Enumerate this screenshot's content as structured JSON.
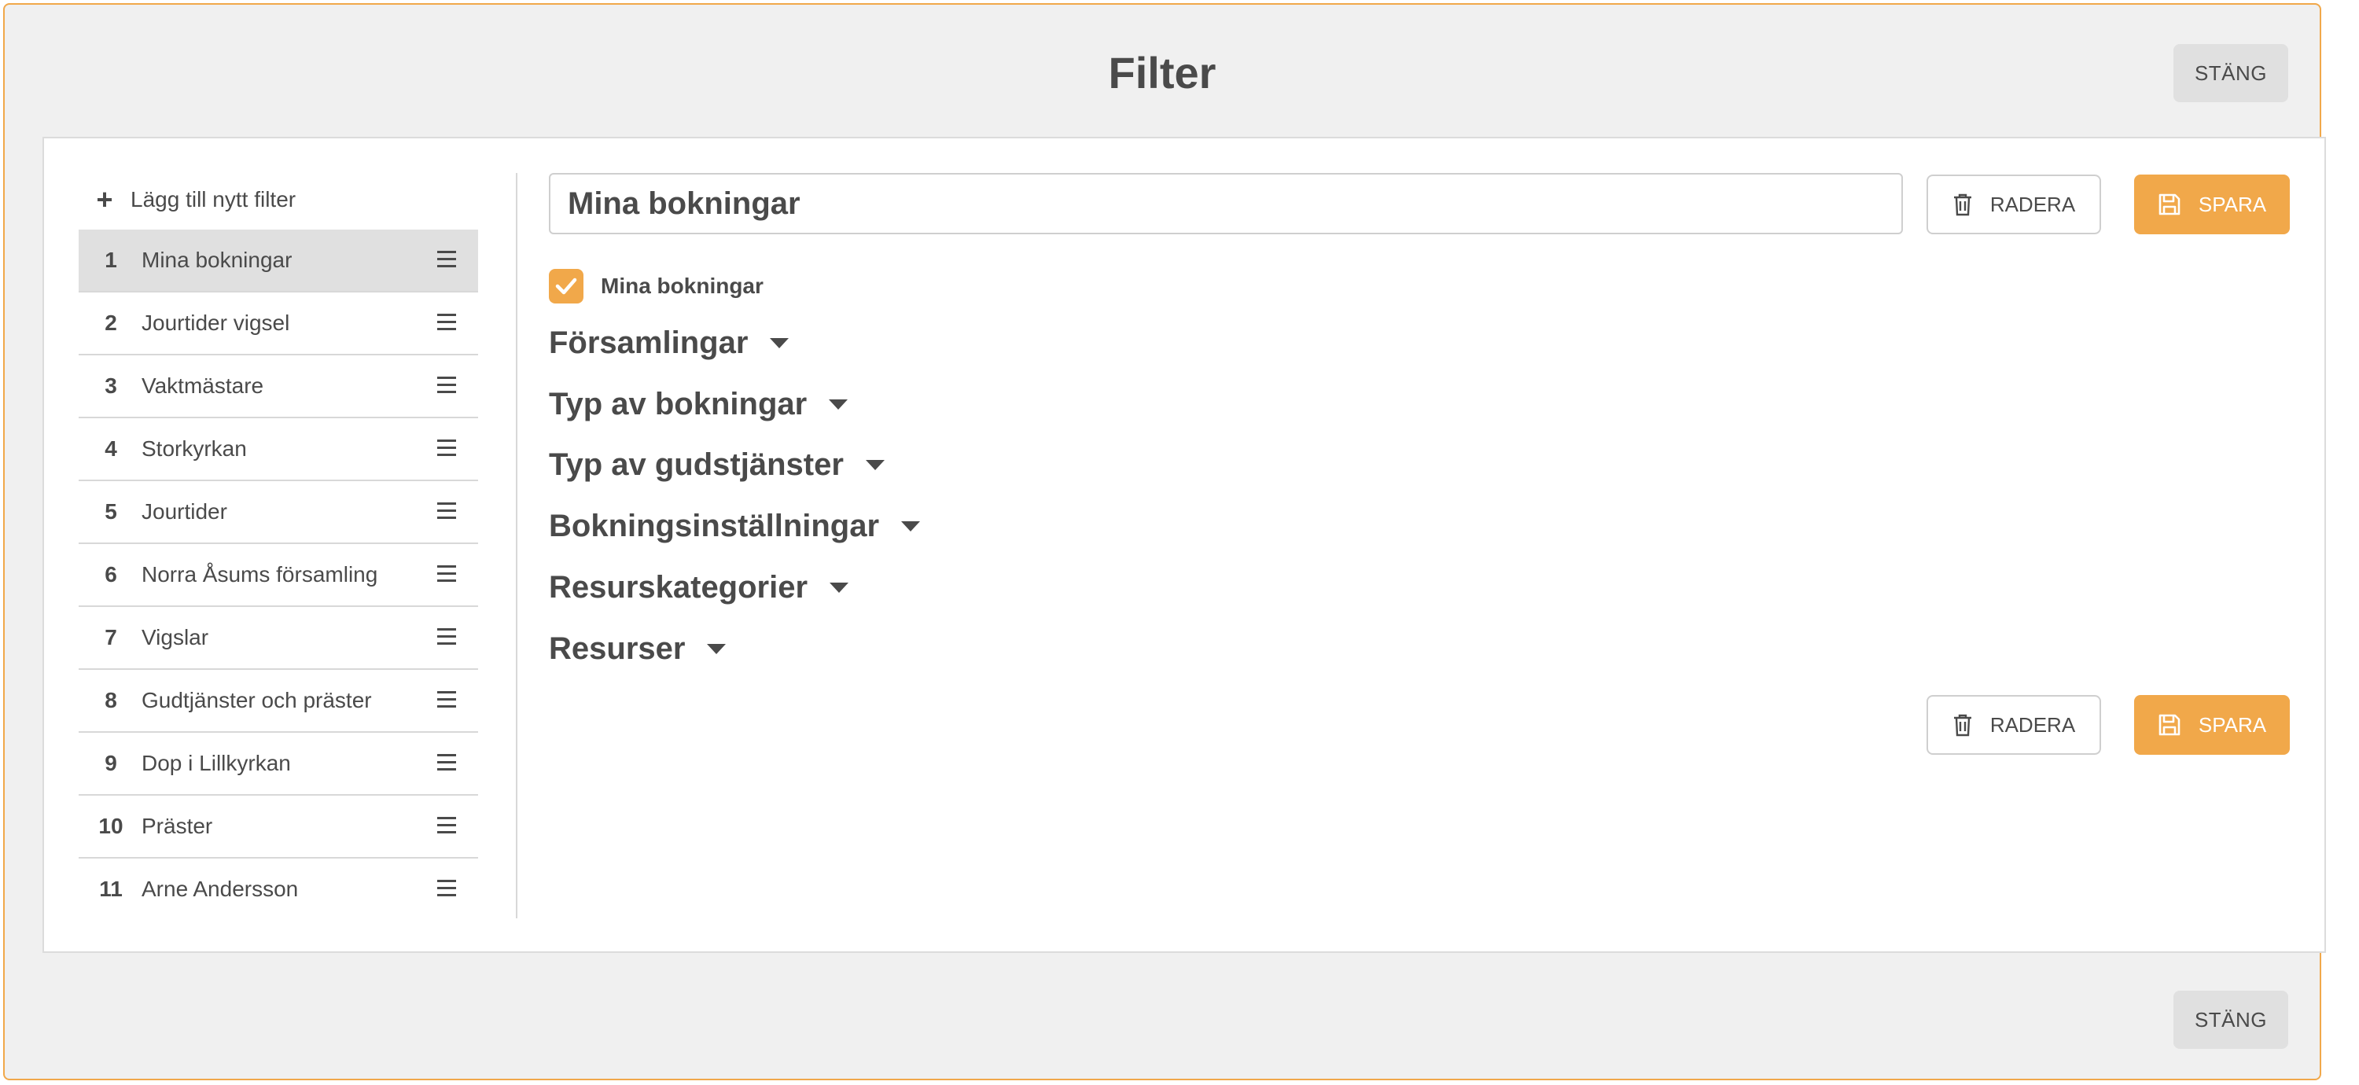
{
  "modal": {
    "title": "Filter",
    "close_label": "STÄNG",
    "accent_color": "#f1a84a"
  },
  "sidebar": {
    "add_label": "Lägg till nytt filter",
    "items": [
      {
        "num": "1",
        "label": "Mina bokningar",
        "active": true
      },
      {
        "num": "2",
        "label": "Jourtider vigsel"
      },
      {
        "num": "3",
        "label": "Vaktmästare"
      },
      {
        "num": "4",
        "label": "Storkyrkan"
      },
      {
        "num": "5",
        "label": "Jourtider"
      },
      {
        "num": "6",
        "label": "Norra Åsums församling"
      },
      {
        "num": "7",
        "label": "Vigslar"
      },
      {
        "num": "8",
        "label": "Gudtjänster och präster"
      },
      {
        "num": "9",
        "label": "Dop i Lillkyrkan"
      },
      {
        "num": "10",
        "label": "Präster"
      },
      {
        "num": "11",
        "label": "Arne Andersson"
      }
    ]
  },
  "editor": {
    "name_value": "Mina bokningar",
    "delete_label": "RADERA",
    "save_label": "SPARA",
    "checkbox_label": "Mina bokningar",
    "checkbox_checked": true,
    "sections": [
      "Församlingar",
      "Typ av bokningar",
      "Typ av gudstjänster",
      "Bokningsinställningar",
      "Resurskategorier",
      "Resurser"
    ]
  }
}
